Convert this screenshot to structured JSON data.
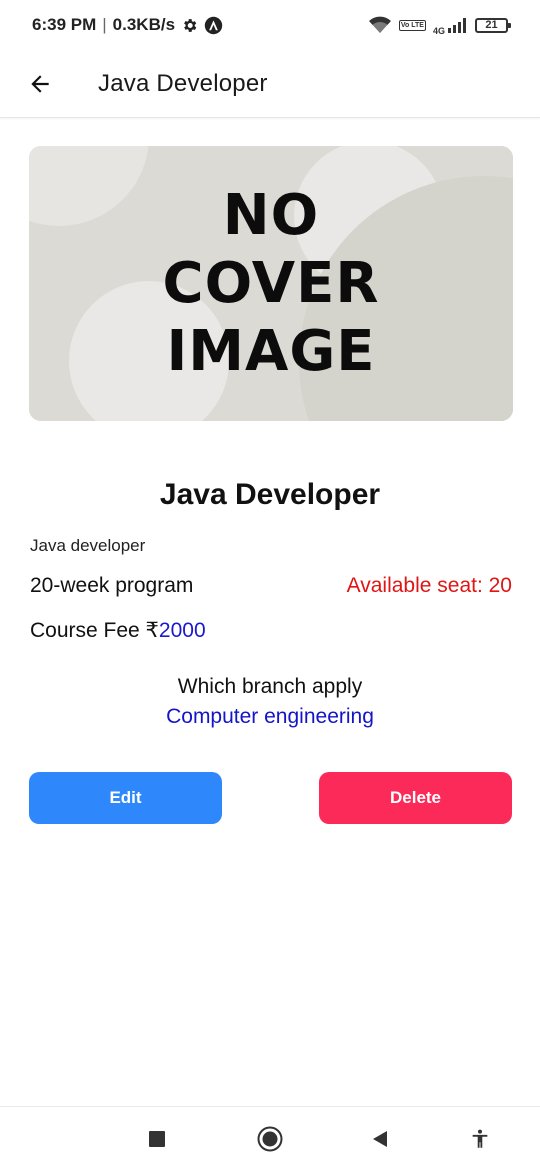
{
  "status_bar": {
    "time": "6:39 PM",
    "separator": "|",
    "speed": "0.3KB/s",
    "network": "4G",
    "volte": "Vo LTE",
    "battery": "21"
  },
  "app_bar": {
    "title": "Java Developer"
  },
  "cover": {
    "line1": "NO",
    "line2": "COVER",
    "line3": "IMAGE"
  },
  "course": {
    "title": "Java Developer",
    "description": "Java developer",
    "duration": "20-week program",
    "seats": "Available seat: 20",
    "fee_label": "Course Fee ₹",
    "fee_value": "2000",
    "branch_label": "Which branch apply",
    "branch_value": "Computer engineering"
  },
  "actions": {
    "edit_label": "Edit",
    "delete_label": "Delete"
  },
  "colors": {
    "edit": "#2e88fb",
    "delete": "#fb2a58",
    "seats": "#e01515",
    "link": "#1414c8"
  }
}
